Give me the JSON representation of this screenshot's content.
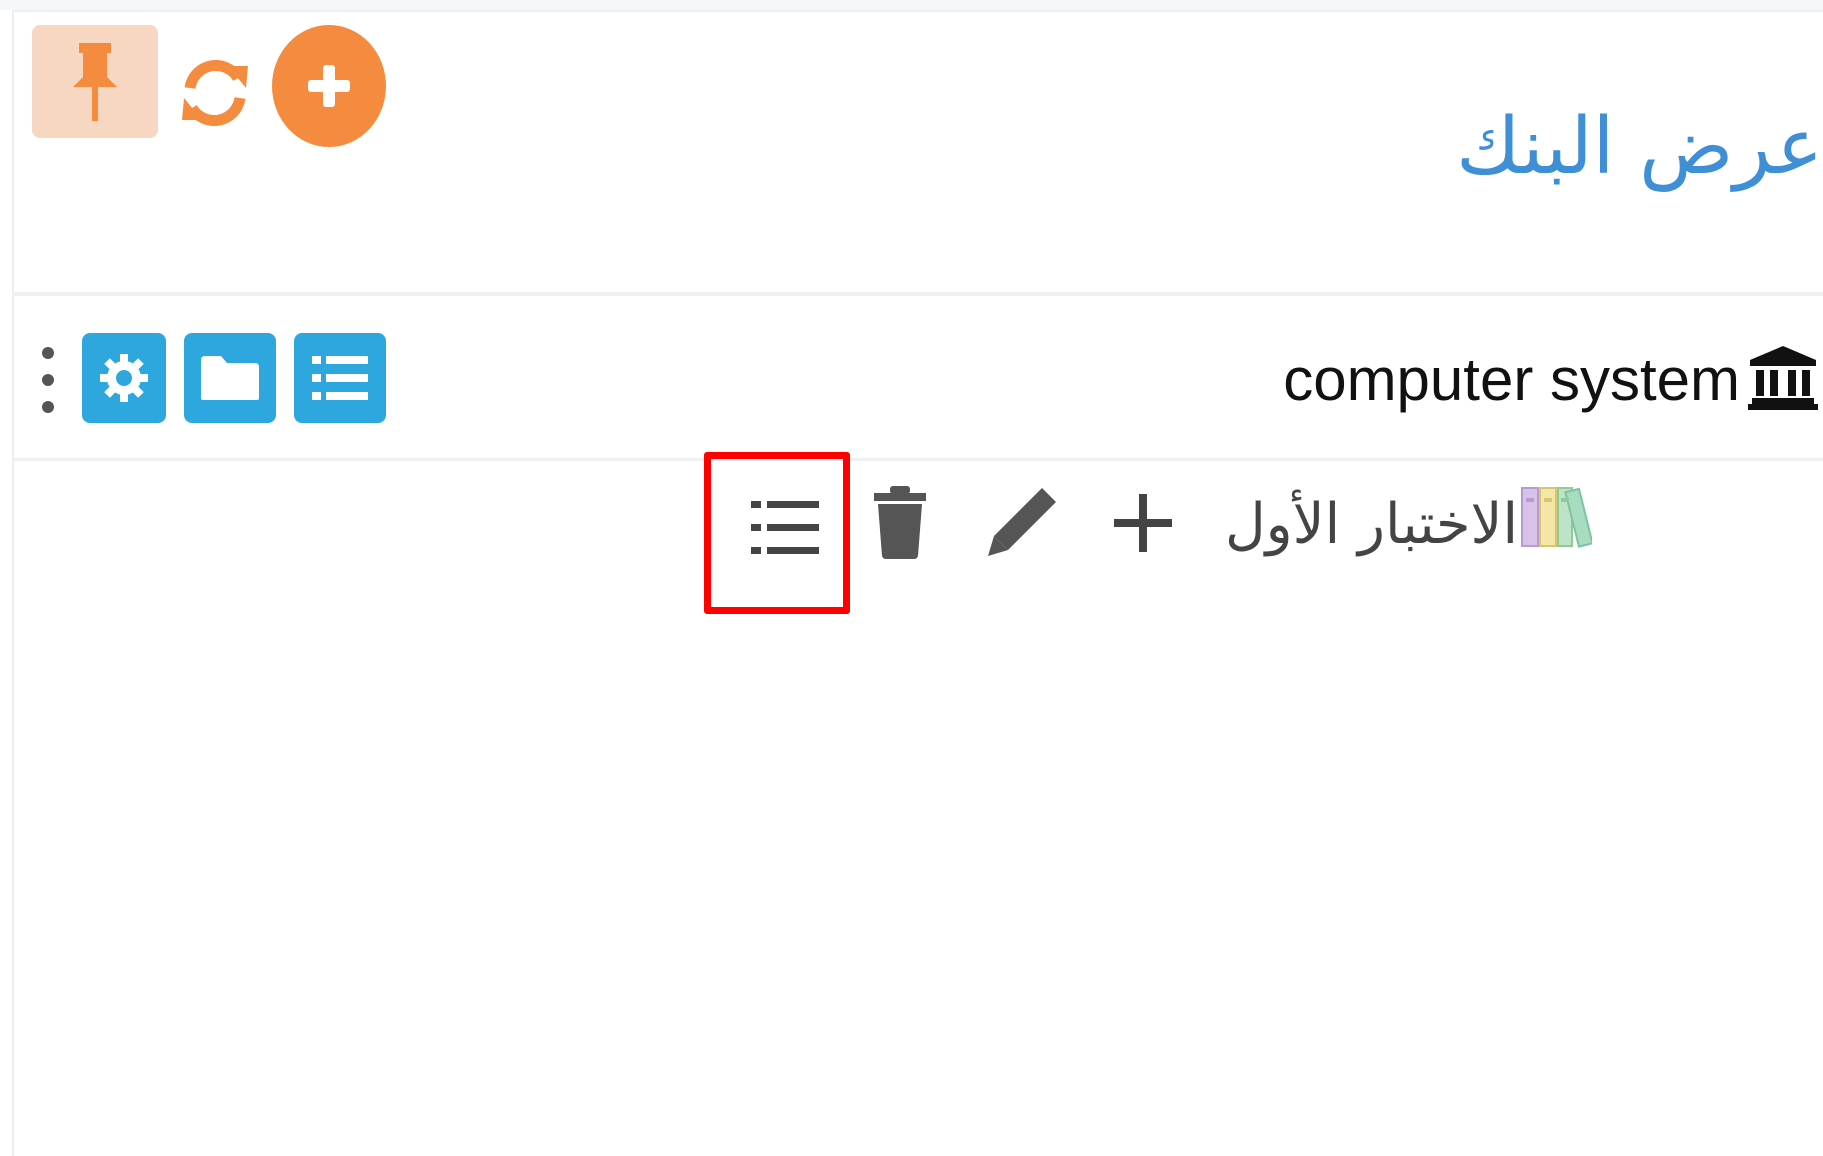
{
  "header": {
    "title": "عرض البنك",
    "pin_icon": "pin-icon",
    "refresh_icon": "refresh-icon",
    "add_icon": "plus-circle-icon"
  },
  "bank": {
    "name": "computer system",
    "icon": "bank-icon",
    "actions": [
      "settings-icon",
      "folder-icon",
      "list-icon"
    ],
    "menu_icon": "kebab-icon"
  },
  "quiz": {
    "title": "الاختبار الأول",
    "icon": "books-icon",
    "actions": [
      "plus-icon",
      "pencil-icon",
      "trash-icon",
      "list-icon"
    ]
  },
  "colors": {
    "accent_orange": "#f58b3f",
    "pin_bg": "#f8d7c2",
    "blue": "#2ea7df",
    "title_blue": "#3f8fd6",
    "highlight_red": "#ff0000",
    "icon_gray": "#555555"
  }
}
